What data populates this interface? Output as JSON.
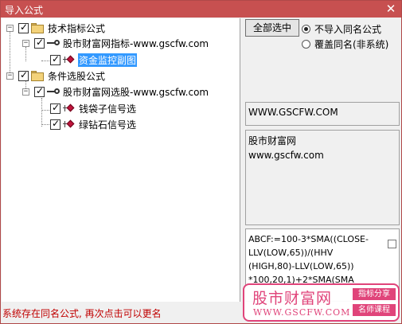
{
  "window": {
    "title": "导入公式",
    "close_glyph": "✕"
  },
  "tree": {
    "groups": [
      {
        "label": "技术指标公式",
        "expander": "−",
        "checked": true,
        "sources": [
          {
            "label": "股市财富网指标-www.gscfw.com",
            "expander": "−",
            "checked": true,
            "items": [
              {
                "label": "资金监控副图",
                "checked": true,
                "selected": true
              }
            ]
          }
        ]
      },
      {
        "label": "条件选股公式",
        "expander": "−",
        "checked": true,
        "sources": [
          {
            "label": "股市财富网选股-www.gscfw.com",
            "expander": "−",
            "checked": true,
            "items": [
              {
                "label": "钱袋子信号选",
                "checked": true,
                "selected": false
              },
              {
                "label": "绿钻石信号选",
                "checked": true,
                "selected": false
              }
            ]
          }
        ]
      }
    ]
  },
  "controls": {
    "select_all_label": "全部选中",
    "radio_options": [
      {
        "label": "不导入同名公式",
        "selected": true
      },
      {
        "label": "覆盖同名(非系统)",
        "selected": false
      }
    ]
  },
  "info": {
    "url": "WWW.GSCFW.COM",
    "description_lines": [
      "股市财富网",
      "www.gscfw.com"
    ],
    "formula_lines": [
      "ABCF:=100-3*SMA((CLOSE-",
      "LLV(LOW,65))/(HHV",
      "(HIGH,80)-LLV(LOW,65))",
      "*100,20,1)+2*SMA(SMA"
    ]
  },
  "status": {
    "message": "系统存在同名公式, 再次点击可以更名"
  },
  "watermark": {
    "title": "股市财富网",
    "url": "WWW.GSCFW.COM",
    "tags": [
      "指标分享",
      "名师课程"
    ]
  }
}
